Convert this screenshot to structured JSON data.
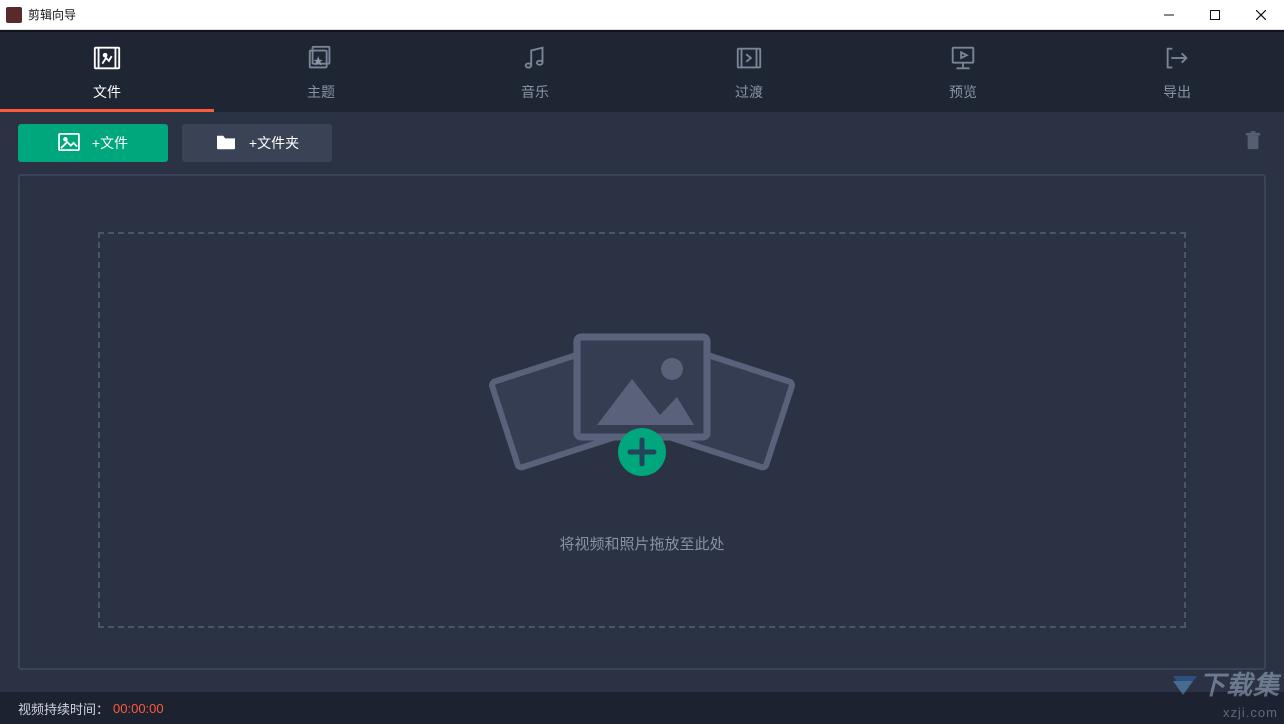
{
  "window": {
    "title": "剪辑向导"
  },
  "wizard": {
    "tabs": [
      {
        "label": "文件",
        "active": true
      },
      {
        "label": "主题",
        "active": false
      },
      {
        "label": "音乐",
        "active": false
      },
      {
        "label": "过渡",
        "active": false
      },
      {
        "label": "预览",
        "active": false
      },
      {
        "label": "导出",
        "active": false
      }
    ]
  },
  "toolbar": {
    "add_file_label": "+文件",
    "add_folder_label": "+文件夹"
  },
  "drop": {
    "hint": "将视频和照片拖放至此处"
  },
  "footer": {
    "duration_label": "视频持续时间：",
    "duration_value": "00:00:00"
  },
  "watermark": {
    "text": "下载集",
    "url_text": "xzji.com"
  }
}
